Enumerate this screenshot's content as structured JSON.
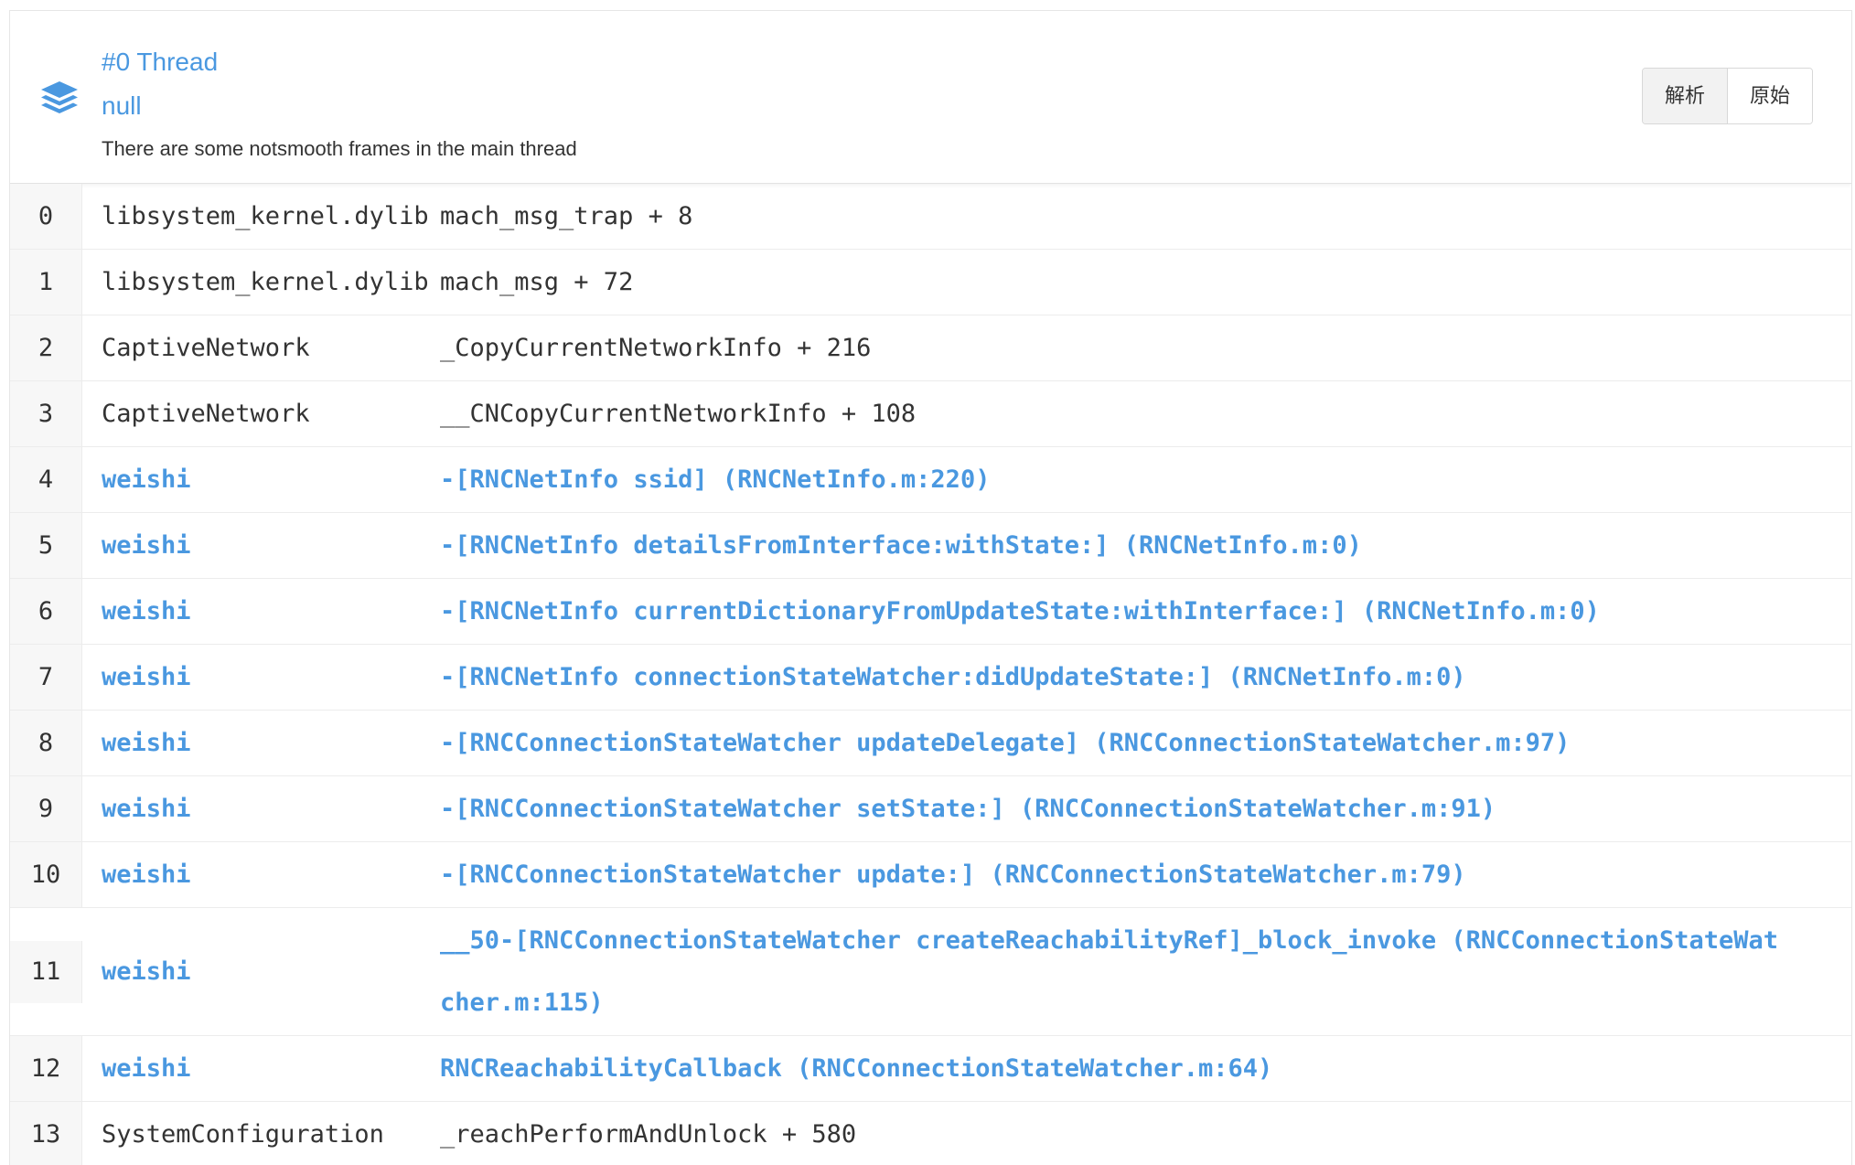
{
  "thread": {
    "title": "#0 Thread",
    "subtitle": "null",
    "description": "There are some notsmooth frames in the main thread",
    "icon": "layers-icon"
  },
  "view_toggle": {
    "parsed_label": "解析",
    "raw_label": "原始",
    "selected": "parsed"
  },
  "colors": {
    "accent": "#4a98e0",
    "text": "#333333",
    "index_bg": "#f7f7f7"
  },
  "frames": [
    {
      "index": "0",
      "library": "libsystem_kernel.dylib",
      "symbol": "mach_msg_trap + 8",
      "app": false
    },
    {
      "index": "1",
      "library": "libsystem_kernel.dylib",
      "symbol": "mach_msg + 72",
      "app": false
    },
    {
      "index": "2",
      "library": "CaptiveNetwork",
      "symbol": "_CopyCurrentNetworkInfo + 216",
      "app": false
    },
    {
      "index": "3",
      "library": "CaptiveNetwork",
      "symbol": "__CNCopyCurrentNetworkInfo + 108",
      "app": false
    },
    {
      "index": "4",
      "library": "weishi",
      "symbol": "-[RNCNetInfo ssid] (RNCNetInfo.m:220)",
      "app": true
    },
    {
      "index": "5",
      "library": "weishi",
      "symbol": "-[RNCNetInfo detailsFromInterface:withState:] (RNCNetInfo.m:0)",
      "app": true
    },
    {
      "index": "6",
      "library": "weishi",
      "symbol": "-[RNCNetInfo currentDictionaryFromUpdateState:withInterface:] (RNCNetInfo.m:0)",
      "app": true
    },
    {
      "index": "7",
      "library": "weishi",
      "symbol": "-[RNCNetInfo connectionStateWatcher:didUpdateState:] (RNCNetInfo.m:0)",
      "app": true
    },
    {
      "index": "8",
      "library": "weishi",
      "symbol": "-[RNCConnectionStateWatcher updateDelegate] (RNCConnectionStateWatcher.m:97)",
      "app": true
    },
    {
      "index": "9",
      "library": "weishi",
      "symbol": "-[RNCConnectionStateWatcher setState:] (RNCConnectionStateWatcher.m:91)",
      "app": true
    },
    {
      "index": "10",
      "library": "weishi",
      "symbol": "-[RNCConnectionStateWatcher update:] (RNCConnectionStateWatcher.m:79)",
      "app": true
    },
    {
      "index": "11",
      "library": "weishi",
      "symbol": "__50-[RNCConnectionStateWatcher createReachabilityRef]_block_invoke (RNCConnectionStateWatcher.m:115)",
      "app": true
    },
    {
      "index": "12",
      "library": "weishi",
      "symbol": "RNCReachabilityCallback (RNCConnectionStateWatcher.m:64)",
      "app": true
    },
    {
      "index": "13",
      "library": "SystemConfiguration",
      "symbol": "_reachPerformAndUnlock + 580",
      "app": false
    }
  ]
}
